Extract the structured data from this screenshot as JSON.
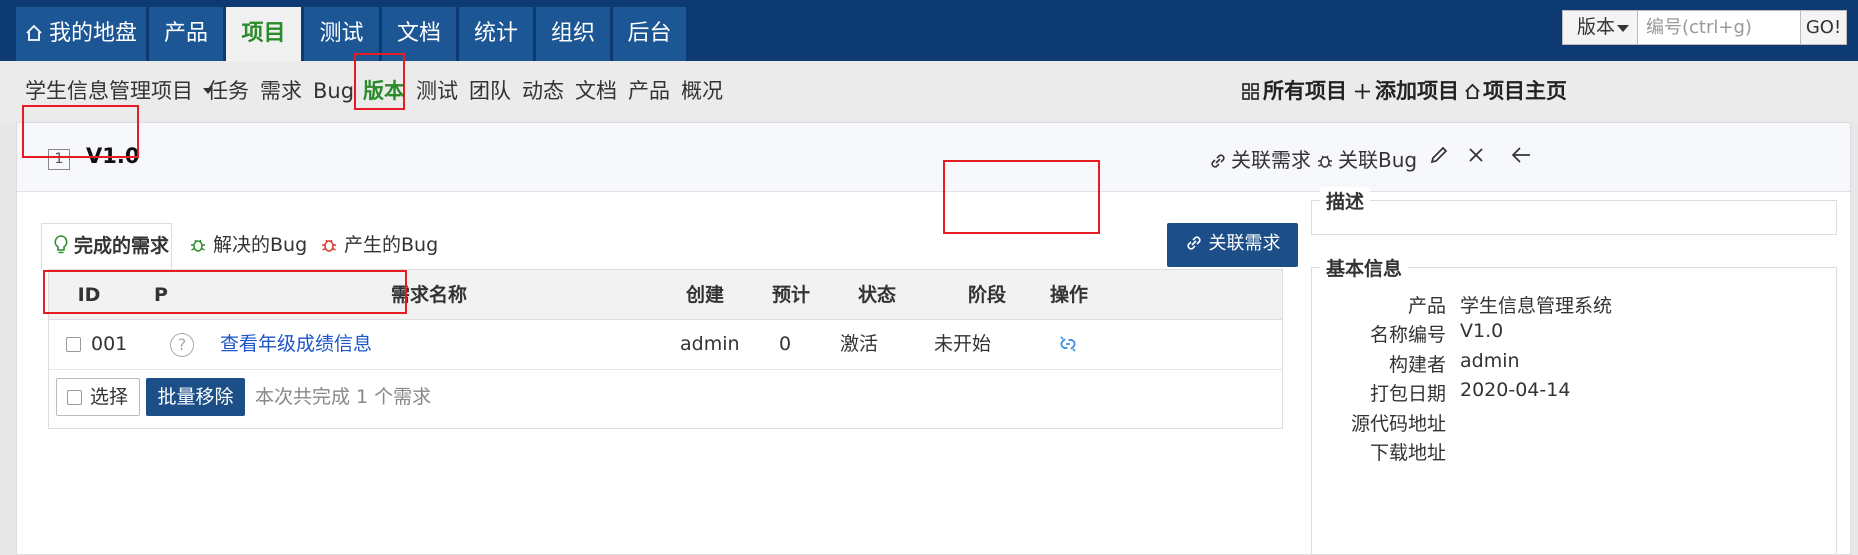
{
  "top_nav": {
    "tabs": [
      {
        "label": "我的地盘",
        "icon": "home-icon"
      },
      {
        "label": "产品"
      },
      {
        "label": "项目"
      },
      {
        "label": "测试"
      },
      {
        "label": "文档"
      },
      {
        "label": "统计"
      },
      {
        "label": "组织"
      },
      {
        "label": "后台"
      }
    ],
    "active_tab": "项目",
    "search": {
      "type_label": "版本",
      "placeholder": "编号(ctrl+g)",
      "go_label": "GO!"
    }
  },
  "sub_nav": {
    "project_name": "学生信息管理项目",
    "items": [
      "任务",
      "需求",
      "Bug",
      "版本",
      "测试",
      "团队",
      "动态",
      "文档",
      "产品",
      "概况"
    ],
    "active_item": "版本",
    "right": {
      "all_projects": "所有项目",
      "add_project": "添加项目",
      "project_home": "项目主页"
    }
  },
  "build": {
    "id_badge": "1",
    "title": "V1.0",
    "actions": {
      "link_story": "关联需求",
      "link_bug": "关联Bug"
    }
  },
  "tabs": [
    {
      "label": "完成的需求",
      "icon": "lightbulb-icon"
    },
    {
      "label": "解决的Bug",
      "icon": "bug-icon"
    },
    {
      "label": "产生的Bug",
      "icon": "bug-icon"
    }
  ],
  "link_story_button": "关联需求",
  "table": {
    "headers": {
      "id": "ID",
      "pri": "P",
      "name": "需求名称",
      "creator": "创建",
      "estimate": "预计",
      "status": "状态",
      "stage": "阶段",
      "actions": "操作"
    },
    "rows": [
      {
        "id": "001",
        "pri": "?",
        "name": "查看年级成绩信息",
        "creator": "admin",
        "estimate": "0",
        "status": "激活",
        "stage": "未开始"
      }
    ],
    "footer": {
      "select_label": "选择",
      "batch_remove": "批量移除",
      "summary": "本次共完成 1 个需求"
    }
  },
  "side": {
    "desc_title": "描述",
    "basic_title": "基本信息",
    "fields": [
      {
        "k": "产品",
        "v": "学生信息管理系统"
      },
      {
        "k": "名称编号",
        "v": "V1.0"
      },
      {
        "k": "构建者",
        "v": "admin"
      },
      {
        "k": "打包日期",
        "v": "2020-04-14"
      },
      {
        "k": "源代码地址",
        "v": ""
      },
      {
        "k": "下载地址",
        "v": ""
      }
    ]
  },
  "colors": {
    "nav_bg": "#0d3a72",
    "tab_bg": "#1c5694",
    "active_green": "#2a8b2a",
    "primary_btn": "#1c4f87",
    "highlight_red": "#e51c23",
    "link_blue": "#1c55c8"
  }
}
